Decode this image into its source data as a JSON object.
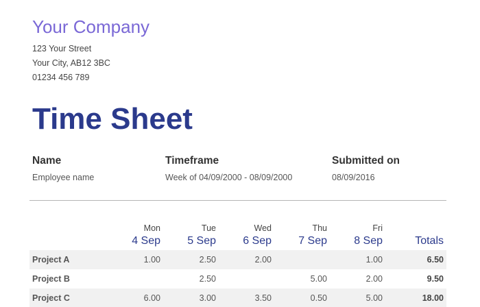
{
  "company": {
    "name": "Your Company",
    "street": "123 Your Street",
    "city": "Your City, AB12 3BC",
    "phone": "01234 456 789"
  },
  "title": "Time Sheet",
  "meta": {
    "name": {
      "label": "Name",
      "value": "Employee name"
    },
    "timeframe": {
      "label": "Timeframe",
      "value": "Week of 04/09/2000 - 08/09/2000"
    },
    "submitted": {
      "label": "Submitted on",
      "value": "08/09/2016"
    }
  },
  "table": {
    "days": [
      {
        "name": "Mon",
        "date": "4 Sep"
      },
      {
        "name": "Tue",
        "date": "5 Sep"
      },
      {
        "name": "Wed",
        "date": "6 Sep"
      },
      {
        "name": "Thu",
        "date": "7 Sep"
      },
      {
        "name": "Fri",
        "date": "8 Sep"
      }
    ],
    "totals_label": "Totals",
    "rows": [
      {
        "project": "Project A",
        "hours": [
          "1.00",
          "2.50",
          "2.00",
          "",
          "1.00"
        ],
        "total": "6.50"
      },
      {
        "project": "Project B",
        "hours": [
          "",
          "2.50",
          "",
          "5.00",
          "2.00"
        ],
        "total": "9.50"
      },
      {
        "project": "Project C",
        "hours": [
          "6.00",
          "3.00",
          "3.50",
          "0.50",
          "5.00"
        ],
        "total": "18.00"
      }
    ]
  }
}
